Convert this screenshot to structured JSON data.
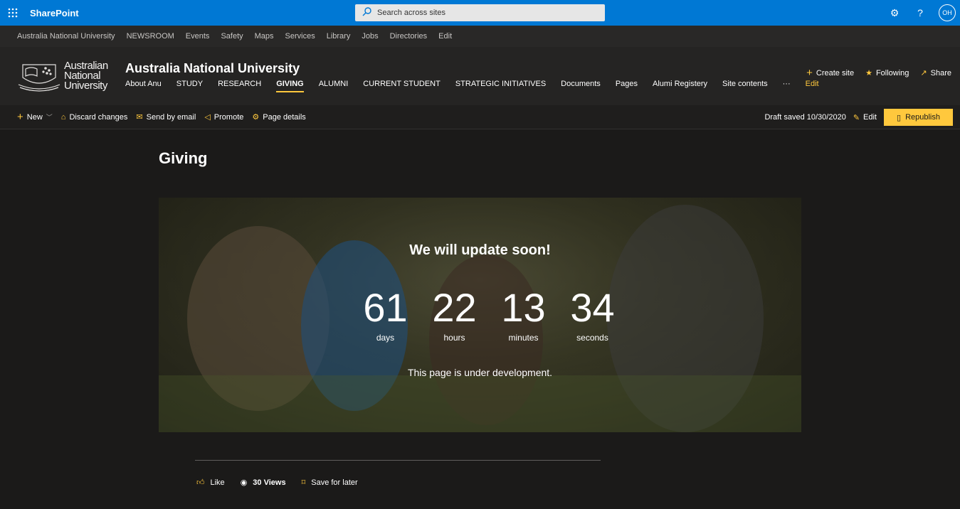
{
  "suite": {
    "brand": "SharePoint",
    "search_placeholder": "Search across sites",
    "avatar_initials": "OH"
  },
  "hubnav": [
    "Australia National University",
    "NEWSROOM",
    "Events",
    "Safety",
    "Maps",
    "Services",
    "Library",
    "Jobs",
    "Directories",
    "Edit"
  ],
  "site": {
    "logo_text": [
      "Australian",
      "National",
      "University"
    ],
    "title": "Australia National University",
    "nav": [
      "About Anu",
      "STUDY",
      "RESEARCH",
      "GIVING",
      "ALUMNI",
      "CURRENT STUDENT",
      "STRATEGIC INITIATIVES",
      "Documents",
      "Pages",
      "Alumi Registery",
      "Site contents",
      "···",
      "Edit"
    ],
    "active_nav": "GIVING",
    "actions": {
      "create": "Create site",
      "following": "Following",
      "share": "Share"
    }
  },
  "cmdbar": {
    "new": "New",
    "discard": "Discard changes",
    "email": "Send by email",
    "promote": "Promote",
    "details": "Page details",
    "draft_status": "Draft saved 10/30/2020",
    "edit": "Edit",
    "republish": "Republish"
  },
  "page": {
    "title": "Giving",
    "hero_heading": "We will update soon!",
    "countdown": [
      {
        "value": "61",
        "label": "days"
      },
      {
        "value": "22",
        "label": "hours"
      },
      {
        "value": "13",
        "label": "minutes"
      },
      {
        "value": "34",
        "label": "seconds"
      }
    ],
    "hero_sub": "This page is under development."
  },
  "footer": {
    "like": "Like",
    "views": "30 Views",
    "save": "Save for later"
  },
  "colors": {
    "suite": "#0078d4",
    "accent": "#ffc83d",
    "bg": "#1b1a19"
  }
}
